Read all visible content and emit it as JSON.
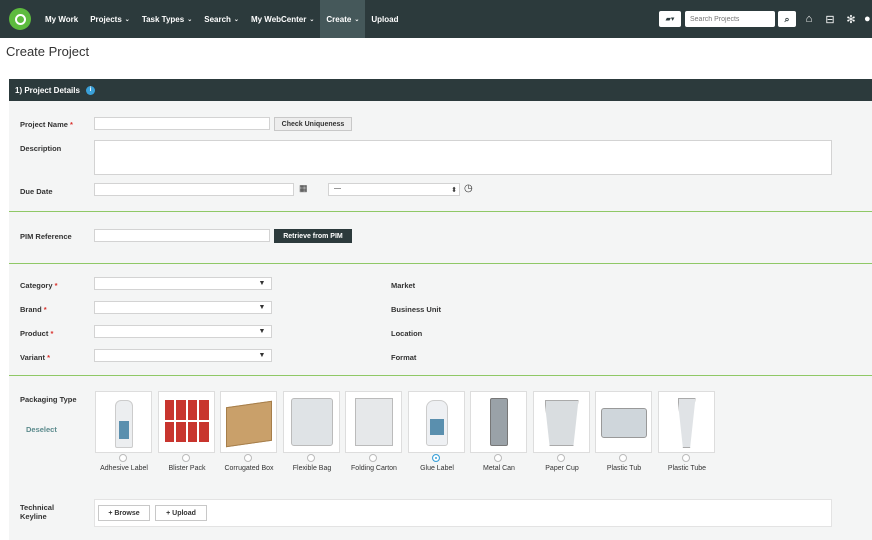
{
  "nav": {
    "items": [
      {
        "label": "My Work",
        "caret": ""
      },
      {
        "label": "Projects",
        "caret": "⌄"
      },
      {
        "label": "Task Types",
        "caret": "⌄"
      },
      {
        "label": "Search",
        "caret": "⌄"
      },
      {
        "label": "My WebCenter",
        "caret": "⌄"
      },
      {
        "label": "Create",
        "caret": "⌄"
      },
      {
        "label": "Upload",
        "caret": ""
      }
    ],
    "search_placeholder": "Search Projects"
  },
  "page": {
    "title": "Create Project"
  },
  "section": {
    "title": "1) Project Details"
  },
  "form": {
    "project_name_label": "Project Name",
    "check_uniqueness_label": "Check Uniqueness",
    "description_label": "Description",
    "due_date_label": "Due Date",
    "time_select_value": "—",
    "pim_reference_label": "PIM Reference",
    "retrieve_pim_label": "Retrieve from PIM",
    "category_label": "Category",
    "brand_label": "Brand",
    "product_label": "Product",
    "variant_label": "Variant",
    "market_label": "Market",
    "business_unit_label": "Business Unit",
    "location_label": "Location",
    "format_label": "Format",
    "packaging_type_label": "Packaging Type",
    "deselect_label": "Deselect",
    "technical_keyline_label": "Technical Keyline",
    "browse_label": "+ Browse",
    "upload_label": "+ Upload",
    "required_mark": "*"
  },
  "packaging": [
    {
      "label": "Adhesive Label",
      "selected": false
    },
    {
      "label": "Blister Pack",
      "selected": false
    },
    {
      "label": "Corrugated Box",
      "selected": false
    },
    {
      "label": "Flexible Bag",
      "selected": false
    },
    {
      "label": "Folding Carton",
      "selected": false
    },
    {
      "label": "Glue Label",
      "selected": true
    },
    {
      "label": "Metal Can",
      "selected": false
    },
    {
      "label": "Paper Cup",
      "selected": false
    },
    {
      "label": "Plastic Tub",
      "selected": false
    },
    {
      "label": "Plastic Tube",
      "selected": false
    }
  ],
  "colors": {
    "topbar": "#2c3a3c",
    "accent_green": "#8fc866",
    "info_blue": "#3aa0d8",
    "required_red": "#d9312c"
  }
}
